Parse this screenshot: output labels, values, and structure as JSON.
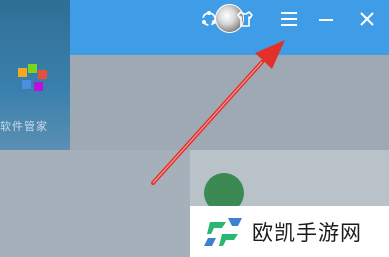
{
  "app": {
    "sidebar_caption": "软件管家",
    "logo_icon": "app-logo-icon"
  },
  "titlebar": {
    "color": "#3f9de8",
    "buttons": [
      {
        "name": "avatar",
        "icon": "user-avatar-icon"
      },
      {
        "name": "skin",
        "icon": "skin-shirt-icon"
      },
      {
        "name": "menu",
        "icon": "hamburger-menu-icon"
      },
      {
        "name": "minimize",
        "icon": "minimize-icon"
      },
      {
        "name": "close",
        "icon": "close-icon"
      }
    ]
  },
  "annotation": {
    "arrow_color": "#e4302b",
    "points_to": "menu"
  },
  "watermark": {
    "text": "欧凯手游网",
    "logo_color": "#2bb673"
  }
}
